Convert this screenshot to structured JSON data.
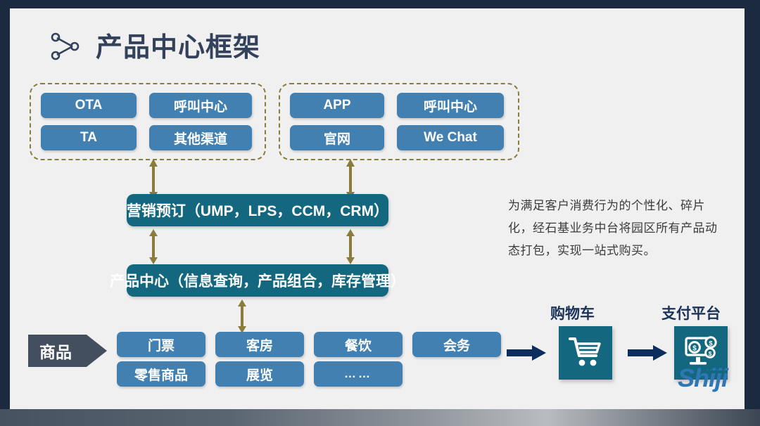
{
  "slide": {
    "title": "产品中心框架",
    "title_icon": "share-network-icon",
    "background_color": "#f0f0f0",
    "frame_color": "#1b2a3f"
  },
  "channel_groups": [
    {
      "name": "left-channel-group",
      "chips": [
        "OTA",
        "呼叫中心",
        "TA",
        "其他渠道"
      ]
    },
    {
      "name": "right-channel-group",
      "chips": [
        "APP",
        "呼叫中心",
        "官网",
        "We Chat"
      ]
    }
  ],
  "platform_bars": [
    {
      "name": "marketing-booking-bar",
      "label": "营销预订（UMP，LPS，CCM，CRM）"
    },
    {
      "name": "product-center-bar",
      "label": "产品中心（信息查询，产品组合，库存管理）"
    }
  ],
  "goods": {
    "tag_label": "商品",
    "columns": [
      {
        "top": "门票",
        "bottom": "零售商品"
      },
      {
        "top": "客房",
        "bottom": "展览"
      },
      {
        "top": "餐饮",
        "bottom": "……"
      },
      {
        "top": "会务",
        "bottom": ""
      }
    ]
  },
  "description": "为满足客户消费行为的个性化、碎片化，经石基业务中台将园区所有产品动态打包，实现一站式购买。",
  "flow": {
    "items": [
      {
        "label": "购物车",
        "icon": "shopping-cart-icon"
      },
      {
        "label": "支付平台",
        "icon": "payment-monitor-icon"
      }
    ]
  },
  "logo": {
    "text": "Shiji",
    "dots": "······"
  },
  "colors": {
    "chip_blue": "#4180b0",
    "bar_teal": "#13677e",
    "dashed_olive": "#8a7c3d",
    "arrow_olive": "#8a7c3d",
    "tag_slate": "#434e5e",
    "nav_arrow_navy": "#0d2d5e",
    "title_navy": "#33415a",
    "logo_blue": "#2f76b5"
  }
}
